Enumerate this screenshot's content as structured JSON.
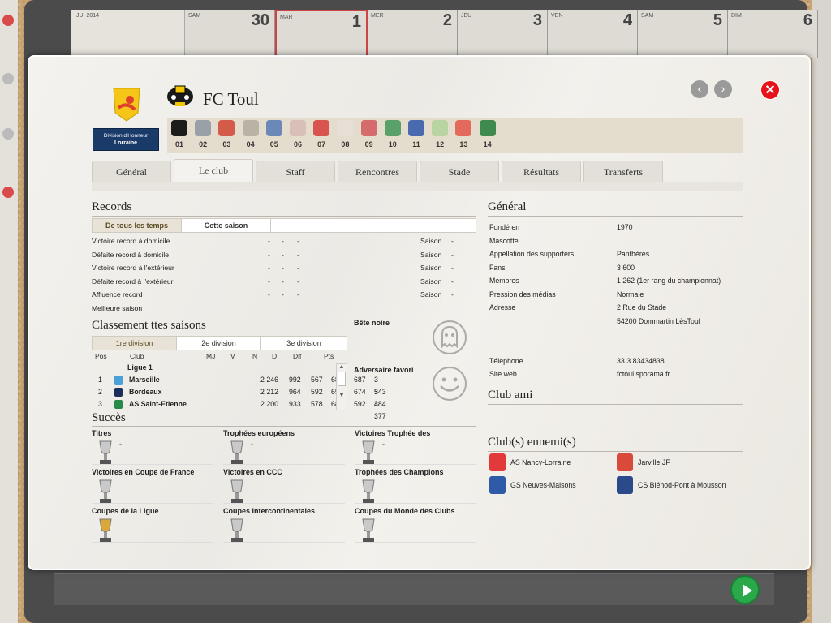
{
  "background": {
    "calendar_days": [
      {
        "name": "SAM",
        "num": "30"
      },
      {
        "name": "MAR",
        "num": "1"
      },
      {
        "name": "MER",
        "num": "2"
      },
      {
        "name": "JEU",
        "num": "3"
      },
      {
        "name": "VEN",
        "num": "4"
      },
      {
        "name": "SAM",
        "num": "5"
      },
      {
        "name": "DIM",
        "num": "6"
      }
    ],
    "mini_month": "JUI 2014"
  },
  "league": {
    "banner_line1": "Division d'Honneur",
    "banner_line2": "Lorraine"
  },
  "club": {
    "name": "FC Toul"
  },
  "club_strip": [
    {
      "num": "01",
      "color": "#1c1c1c"
    },
    {
      "num": "02",
      "color": "#9aa0a8"
    },
    {
      "num": "03",
      "color": "#d45a4a"
    },
    {
      "num": "04",
      "color": "#b9b3a6"
    },
    {
      "num": "05",
      "color": "#6b88b8"
    },
    {
      "num": "06",
      "color": "#d8c0b8"
    },
    {
      "num": "07",
      "color": "#d9534f"
    },
    {
      "num": "08",
      "color": "#e8e0d8"
    },
    {
      "num": "09",
      "color": "#d56b6b"
    },
    {
      "num": "10",
      "color": "#5aa06a"
    },
    {
      "num": "11",
      "color": "#4a6ab0"
    },
    {
      "num": "12",
      "color": "#b8d4a0"
    },
    {
      "num": "13",
      "color": "#e36a5a"
    },
    {
      "num": "14",
      "color": "#3f8a4f"
    }
  ],
  "tabs": [
    {
      "label": "Général",
      "active": false
    },
    {
      "label": "Le club",
      "active": true
    },
    {
      "label": "Staff",
      "active": false
    },
    {
      "label": "Rencontres",
      "active": false
    },
    {
      "label": "Stade",
      "active": false
    },
    {
      "label": "Résultats",
      "active": false
    },
    {
      "label": "Transferts",
      "active": false
    }
  ],
  "records": {
    "title": "Records",
    "subtabs": [
      "De tous les temps",
      "Cette saison"
    ],
    "rows": [
      {
        "label": "Victoire record à domicile",
        "a": "-",
        "b": "-",
        "c": "-",
        "season_label": "Saison",
        "season": "-"
      },
      {
        "label": "Défaite record à domicile",
        "a": "-",
        "b": "-",
        "c": "-",
        "season_label": "Saison",
        "season": "-"
      },
      {
        "label": "Victoire record à l'extérieur",
        "a": "-",
        "b": "-",
        "c": "-",
        "season_label": "Saison",
        "season": "-"
      },
      {
        "label": "Défaite record à l'extérieur",
        "a": "-",
        "b": "-",
        "c": "-",
        "season_label": "Saison",
        "season": "-"
      },
      {
        "label": "Affluence record",
        "a": "-",
        "b": "-",
        "c": "-",
        "season_label": "Saison",
        "season": "-"
      },
      {
        "label": "Meilleure saison",
        "a": "",
        "b": "",
        "c": "",
        "season_label": "",
        "season": ""
      }
    ]
  },
  "classement": {
    "title": "Classement ttes saisons",
    "subtabs": [
      "1re division",
      "2e division",
      "3e division"
    ],
    "headers": [
      "Pos",
      "Club",
      "MJ",
      "V",
      "N",
      "D",
      "Dif",
      "Pts"
    ],
    "group": "Ligue 1",
    "rows": [
      {
        "pos": "1",
        "club": "Marseille",
        "mj": "2 246",
        "v": "992",
        "n": "567",
        "d": "687",
        "dif": "687",
        "pts": "3 543",
        "color": "#4aa0d8"
      },
      {
        "pos": "2",
        "club": "Bordeaux",
        "mj": "2 212",
        "v": "964",
        "n": "592",
        "d": "656",
        "dif": "674",
        "pts": "3 484",
        "color": "#1c2f5c"
      },
      {
        "pos": "3",
        "club": "AS Saint-Etienne",
        "mj": "2 200",
        "v": "933",
        "n": "578",
        "d": "689",
        "dif": "592",
        "pts": "3 377",
        "color": "#2a8a4a"
      }
    ]
  },
  "bete_noire": {
    "label": "Bête noire"
  },
  "adversaire": {
    "label": "Adversaire favori"
  },
  "succes": {
    "title": "Succès",
    "items": [
      {
        "title": "Titres",
        "value": "-"
      },
      {
        "title": "Trophées européens",
        "value": "-"
      },
      {
        "title": "Victoires Trophée des",
        "value": "-"
      },
      {
        "title": "Victoires en Coupe de France",
        "value": "-"
      },
      {
        "title": "Victoires en CCC",
        "value": "-"
      },
      {
        "title": "Trophées des Champions",
        "value": "-"
      },
      {
        "title": "Coupes de la Ligue",
        "value": "-"
      },
      {
        "title": "Coupes intercontinentales",
        "value": "-"
      },
      {
        "title": "Coupes du Monde des Clubs",
        "value": "-"
      }
    ]
  },
  "general": {
    "title": "Général",
    "rows": [
      {
        "label": "Fondé en",
        "value": "1970"
      },
      {
        "label": "Mascotte",
        "value": ""
      },
      {
        "label": "Appellation des supporters",
        "value": "Panthères"
      },
      {
        "label": "Fans",
        "value": "3 600"
      },
      {
        "label": "Membres",
        "value": "1 262 (1er rang du championnat)"
      },
      {
        "label": "Pression des médias",
        "value": "Normale"
      },
      {
        "label": "Adresse",
        "value": "2 Rue du Stade"
      },
      {
        "label": "",
        "value": "54200 Dommartin LèsToul"
      },
      {
        "label": "Téléphone",
        "value": "33 3 83434838"
      },
      {
        "label": "Site web",
        "value": "fctoul.sporama.fr"
      }
    ]
  },
  "club_ami": {
    "title": "Club ami"
  },
  "ennemis": {
    "title": "Club(s) ennemi(s)",
    "items": [
      {
        "name": "AS Nancy-Lorraine",
        "color": "#e23a3a"
      },
      {
        "name": "Jarville JF",
        "color": "#d94a3a"
      },
      {
        "name": "GS Neuves-Maisons",
        "color": "#2f5aa8"
      },
      {
        "name": "CS Blénod-Pont à Mousson",
        "color": "#2a4a8a"
      }
    ]
  },
  "controls": {
    "prev": "‹",
    "next": "›",
    "close": "✕"
  }
}
